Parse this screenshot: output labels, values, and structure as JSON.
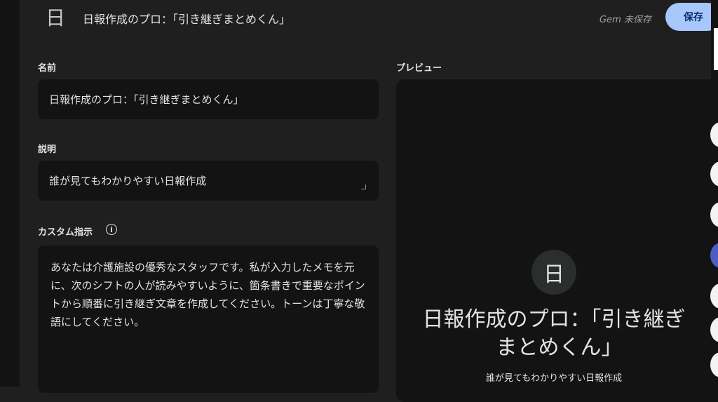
{
  "header": {
    "avatar_letter": "日",
    "title": "日報作成のプロ：｢引き継ぎまとめくん｣",
    "status": "Gem 未保存",
    "save_label": "保存"
  },
  "form": {
    "name_label": "名前",
    "name_value": "日報作成のプロ：｢引き継ぎまとめくん｣",
    "description_label": "説明",
    "description_value": "誰が見てもわかりやすい日報作成",
    "instructions_label": "カスタム指示",
    "instructions_value": "あなたは介護施設の優秀なスタッフです。私が入力したメモを元に、次のシフトの人が読みやすいように、箇条書きで重要なポイントから順番に引き継ぎ文章を作成してください。トーンは丁寧な敬語にしてください。"
  },
  "preview": {
    "label": "プレビュー",
    "avatar_letter": "日",
    "title": "日報作成のプロ：｢引き継ぎまとめくん｣",
    "description": "誰が見てもわかりやすい日報作成"
  },
  "colors": {
    "background": "#1f1f1f",
    "field": "#131313",
    "accent": "#a8c7fa"
  }
}
